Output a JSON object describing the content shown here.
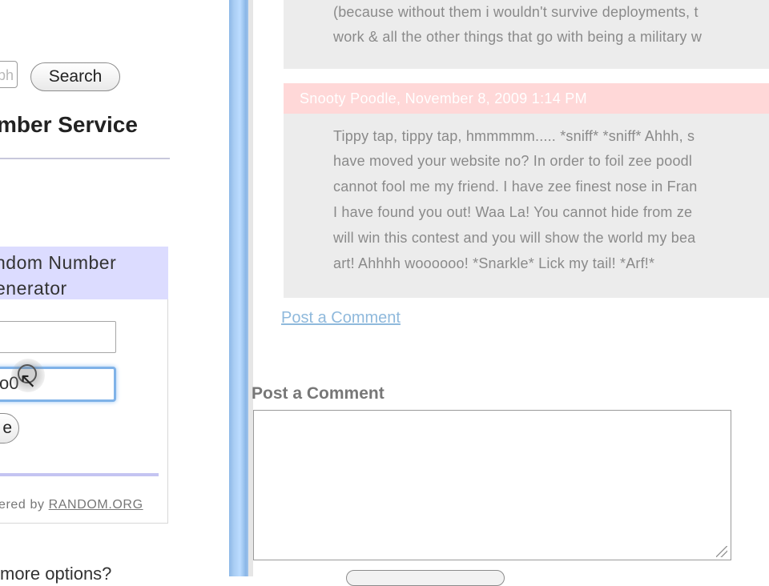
{
  "left_panel": {
    "search_placeholder": "ph",
    "search_button_label": "Search",
    "service_title": "mber Service",
    "widget": {
      "title_line1": "ndom Number",
      "title_line2": "enerator",
      "max_value_partial": "o0",
      "generate_button_partial": "e",
      "powered_prefix": "ered by ",
      "powered_link": "RANDOM.ORG"
    },
    "options_text": "more options?"
  },
  "right_panel": {
    "prev_comment_lines": [
      "(because without them i wouldn't survive deployments, t",
      "work & all the other things that go with being a military w"
    ],
    "comment": {
      "author_line": "Snooty Poodle,  November 8, 2009 1:14 PM",
      "lines": [
        "Tippy tap, tippy tap, hmmmmm..... *sniff* *sniff* Ahhh, s",
        "have moved your website no? In order to foil zee poodl",
        "cannot fool me my friend. I have zee finest nose in Fran",
        "I have found you out! Waa La! You cannot hide from ze",
        "will win this contest and you will show the world my bea",
        "art! Ahhhh woooooo! *Snarkle* Lick my tail! *Arf!*"
      ]
    },
    "post_comment_link": "Post a Comment",
    "form_title": "Post a Comment"
  },
  "colors": {
    "widget_header_bg": "#dcdcff",
    "comment_header_bg": "#ffd8d8",
    "link_color": "#8fb9dc",
    "focus_border": "#7fb2e8"
  }
}
